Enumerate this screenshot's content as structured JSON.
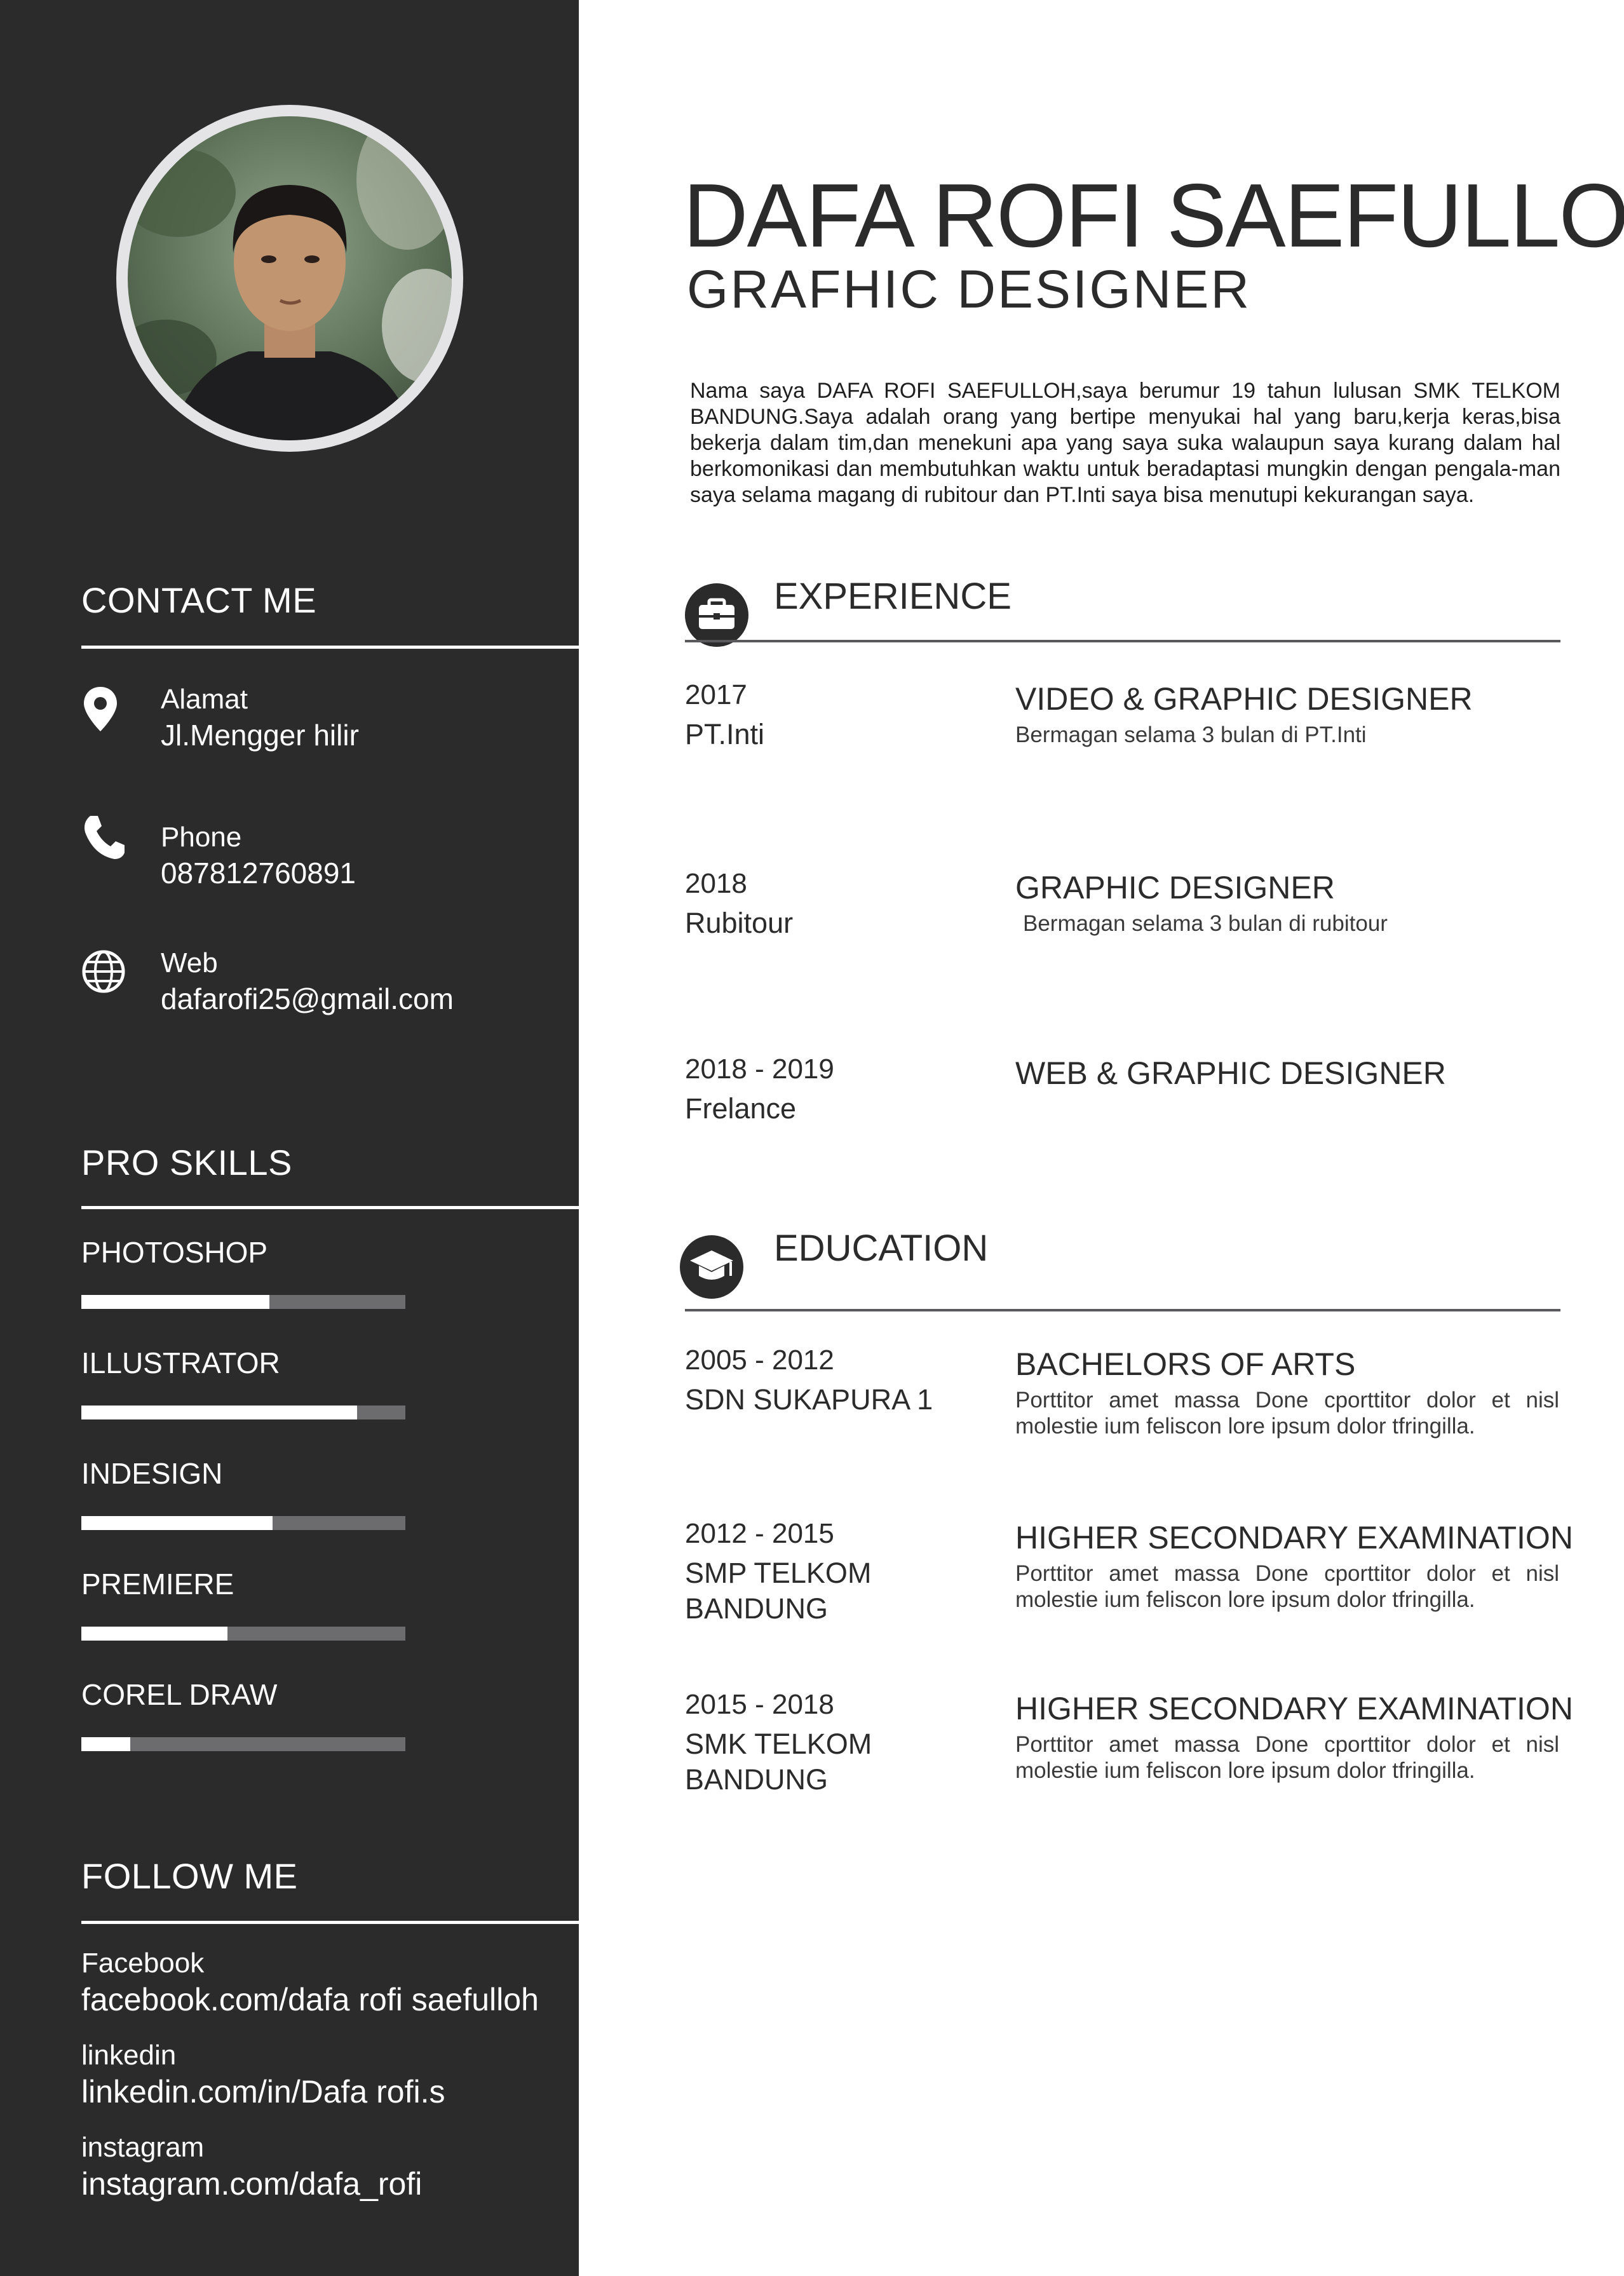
{
  "colors": {
    "sidebar": "#2b2b2c",
    "text": "#2b2b2c",
    "skill_track": "#6c6c6e",
    "skill_fill": "#ffffff"
  },
  "header": {
    "name": "DAFA ROFI SAEFULLOH",
    "role": "GRAFHIC DESIGNER",
    "about": "Nama saya DAFA ROFI SAEFULLOH,saya berumur 19 tahun lulusan SMK TELKOM BANDUNG.Saya adalah orang yang bertipe menyukai hal yang baru,kerja keras,bisa bekerja dalam tim,dan menekuni apa yang saya suka walaupun saya kurang dalam hal berkomonikasi dan membutuhkan waktu untuk beradaptasi mungkin dengan pengala-man saya selama magang di rubitour dan PT.Inti saya bisa menutupi kekurangan saya."
  },
  "contact": {
    "heading": "CONTACT ME",
    "items": [
      {
        "icon": "location-pin-icon",
        "label": "Alamat",
        "value": "Jl.Mengger hilir"
      },
      {
        "icon": "phone-icon",
        "label": "Phone",
        "value": "087812760891"
      },
      {
        "icon": "globe-icon",
        "label": "Web",
        "value": "dafarofi25@gmail.com"
      }
    ]
  },
  "skills": {
    "heading": "PRO SKILLS",
    "items": [
      {
        "name": "PHOTOSHOP",
        "level": 0.58
      },
      {
        "name": "ILLUSTRATOR",
        "level": 0.85
      },
      {
        "name": "INDESIGN",
        "level": 0.59
      },
      {
        "name": "PREMIERE",
        "level": 0.45
      },
      {
        "name": "COREL DRAW",
        "level": 0.15
      }
    ]
  },
  "follow": {
    "heading": "FOLLOW ME",
    "items": [
      {
        "label": "Facebook",
        "value": "facebook.com/dafa rofi saefulloh"
      },
      {
        "label": "linkedin",
        "value": "linkedin.com/in/Dafa rofi.s"
      },
      {
        "label": "instagram",
        "value": "instagram.com/dafa_rofi"
      }
    ]
  },
  "experience": {
    "icon": "briefcase-icon",
    "heading": "EXPERIENCE",
    "items": [
      {
        "date": "2017",
        "org": "PT.Inti",
        "title": "VIDEO & GRAPHIC DESIGNER",
        "desc": "Bermagan selama 3 bulan di PT.Inti"
      },
      {
        "date": "2018",
        "org": "Rubitour",
        "title": "GRAPHIC DESIGNER",
        "desc": "Bermagan selama 3 bulan di rubitour"
      },
      {
        "date": "2018 - 2019",
        "org": "Frelance",
        "title": "WEB & GRAPHIC DESIGNER",
        "desc": ""
      }
    ]
  },
  "education": {
    "icon": "graduation-cap-icon",
    "heading": "EDUCATION",
    "items": [
      {
        "date": "2005 - 2012",
        "org": "SDN SUKAPURA 1",
        "title": "BACHELORS OF ARTS",
        "desc": "Porttitor amet massa Done cporttitor dolor et nisl molestie ium feliscon lore ipsum dolor tfringilla."
      },
      {
        "date": "2012 - 2015",
        "org": "SMP TELKOM BANDUNG",
        "title": "HIGHER SECONDARY EXAMINATION",
        "desc": "Porttitor amet massa Done cporttitor dolor et nisl molestie ium feliscon lore ipsum dolor tfringilla."
      },
      {
        "date": "2015 - 2018",
        "org": "SMK TELKOM BANDUNG",
        "title": "HIGHER SECONDARY EXAMINATION",
        "desc": "Porttitor amet massa Done cporttitor dolor et nisl molestie ium feliscon lore ipsum dolor tfringilla."
      }
    ]
  }
}
